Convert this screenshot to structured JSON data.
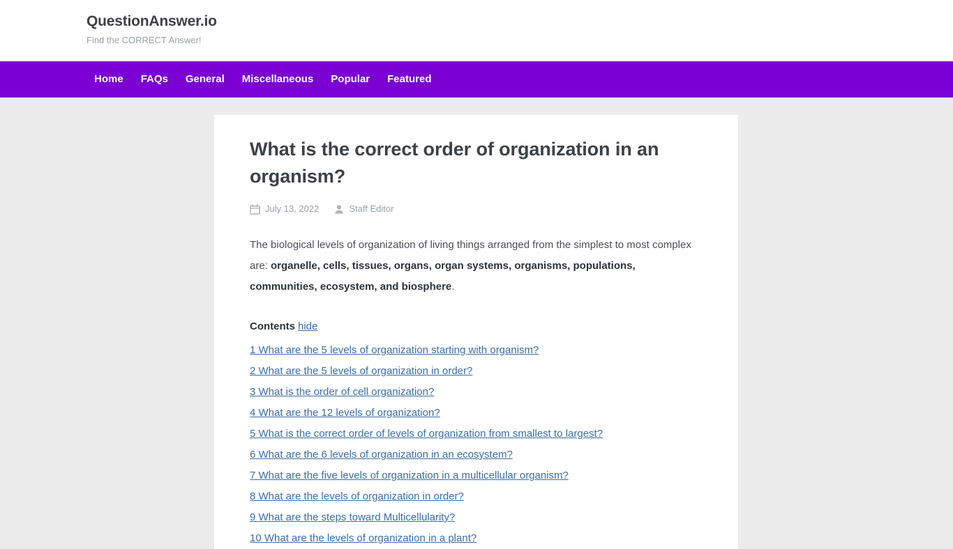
{
  "site": {
    "title": "QuestionAnswer.io",
    "tagline": "Find the CORRECT Answer!"
  },
  "nav": {
    "items": [
      {
        "label": "Home"
      },
      {
        "label": "FAQs"
      },
      {
        "label": "General"
      },
      {
        "label": "Miscellaneous"
      },
      {
        "label": "Popular"
      },
      {
        "label": "Featured"
      }
    ]
  },
  "article": {
    "title": "What is the correct order of organization in an organism?",
    "meta": {
      "date_icon": "calendar-icon",
      "date": "July 13, 2022",
      "author_icon": "user-icon",
      "author": "Staff Editor"
    },
    "intro": {
      "lead": "The biological levels of organization of living things arranged from the simplest to most complex are: ",
      "emphasis": "organelle, cells, tissues, organs, organ systems, organisms, populations, communities, ecosystem, and biosphere",
      "tail": "."
    }
  },
  "toc": {
    "title": "Contents",
    "toggle_label": "hide",
    "items": [
      {
        "label": "1 What are the 5 levels of organization starting with organism?"
      },
      {
        "label": "2 What are the 5 levels of organization in order?"
      },
      {
        "label": "3 What is the order of cell organization?"
      },
      {
        "label": "4 What are the 12 levels of organization?"
      },
      {
        "label": "5 What is the correct order of levels of organization from smallest to largest?"
      },
      {
        "label": "6 What are the 6 levels of organization in an ecosystem?"
      },
      {
        "label": "7 What are the five levels of organization in a multicellular organism?"
      },
      {
        "label": "8 What are the levels of organization in order?"
      },
      {
        "label": "9 What are the steps toward Multicellularity?"
      },
      {
        "label": "10 What are the levels of organization in a plant?"
      }
    ]
  },
  "colors": {
    "nav_background": "#7a00d4",
    "link": "#3a6ea5",
    "page_background": "#ececec",
    "card_background": "#ffffff",
    "heading": "#3d4148"
  }
}
